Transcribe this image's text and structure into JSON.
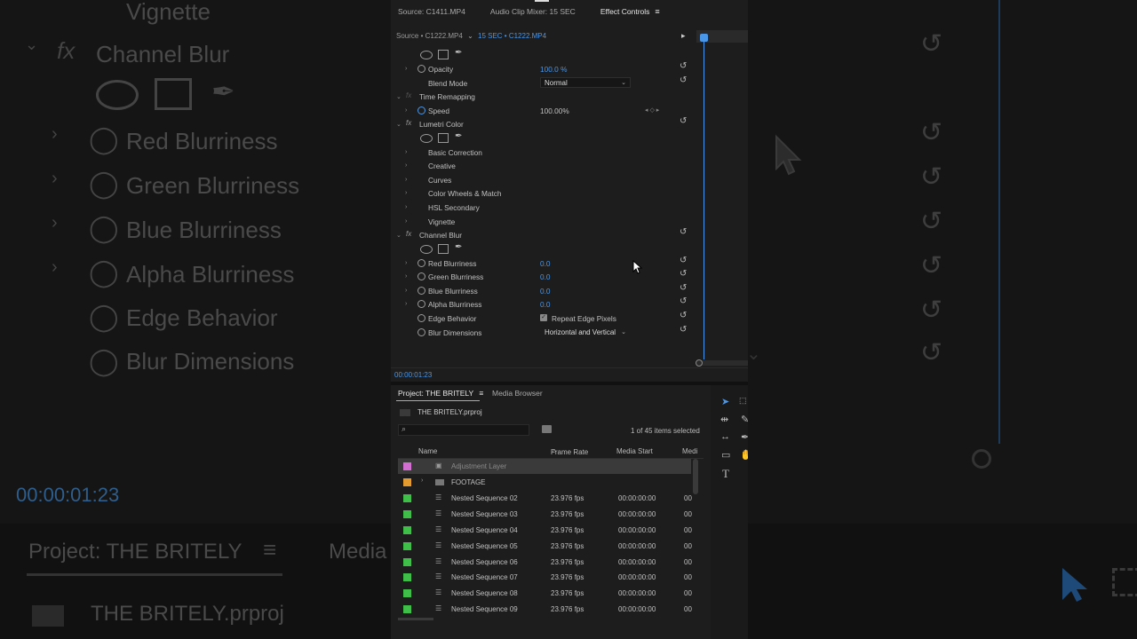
{
  "background": {
    "left_items": [
      "Vignette",
      "Channel Blur",
      "Red Blurriness",
      "Green Blurriness",
      "Blue Blurriness",
      "Alpha Blurriness",
      "Edge Behavior",
      "Blur Dimensions"
    ],
    "timecode": "00:00:01:23",
    "project_tab": "Project: THE BRITELY",
    "media_tab": "Media",
    "file": "THE BRITELY.prproj"
  },
  "tabs": {
    "source": "Source: C1411.MP4",
    "audio_mixer": "Audio Clip Mixer: 15 SEC",
    "effect_controls": "Effect Controls"
  },
  "source_bar": {
    "master": "Source • C1222.MP4",
    "sequence": "15 SEC • C1222.MP4"
  },
  "effects": {
    "opacity_label": "Opacity",
    "opacity_value": "100.0 %",
    "blend_label": "Blend Mode",
    "blend_value": "Normal",
    "time_remap": "Time Remapping",
    "speed_label": "Speed",
    "speed_value": "100.00%",
    "lumetri": "Lumetri Color",
    "lumetri_items": [
      "Basic Correction",
      "Creative",
      "Curves",
      "Color Wheels & Match",
      "HSL Secondary",
      "Vignette"
    ],
    "channel_blur": "Channel Blur",
    "red": "Red Blurriness",
    "red_value": "0.0",
    "green": "Green Blurriness",
    "green_value": "0.0",
    "blue": "Blue Blurriness",
    "blue_value": "0.0",
    "alpha": "Alpha Blurriness",
    "alpha_value": "0.0",
    "edge": "Edge Behavior",
    "edge_value": "Repeat Edge Pixels",
    "dims": "Blur Dimensions",
    "dims_value": "Horizontal and Vertical"
  },
  "timecode": "00:00:01:23",
  "project": {
    "tab": "Project: THE BRITELY",
    "media_browser": "Media Browser",
    "file": "THE BRITELY.prproj",
    "selection": "1 of 45 items selected",
    "columns": {
      "name": "Name",
      "frame_rate": "Frame Rate",
      "media_start": "Media Start",
      "more": "Medi"
    },
    "rows": [
      {
        "name": "Adjustment Layer",
        "fps": "",
        "start": "",
        "more": "",
        "color": "#d36fd3"
      },
      {
        "name": "FOOTAGE",
        "fps": "",
        "start": "",
        "more": "",
        "color": "#e39a2f"
      },
      {
        "name": "Nested Sequence 02",
        "fps": "23.976 fps",
        "start": "00:00:00:00",
        "more": "00",
        "color": "#3fbf4a"
      },
      {
        "name": "Nested Sequence 03",
        "fps": "23.976 fps",
        "start": "00:00:00:00",
        "more": "00",
        "color": "#3fbf4a"
      },
      {
        "name": "Nested Sequence 04",
        "fps": "23.976 fps",
        "start": "00:00:00:00",
        "more": "00",
        "color": "#3fbf4a"
      },
      {
        "name": "Nested Sequence 05",
        "fps": "23.976 fps",
        "start": "00:00:00:00",
        "more": "00",
        "color": "#3fbf4a"
      },
      {
        "name": "Nested Sequence 06",
        "fps": "23.976 fps",
        "start": "00:00:00:00",
        "more": "00",
        "color": "#3fbf4a"
      },
      {
        "name": "Nested Sequence 07",
        "fps": "23.976 fps",
        "start": "00:00:00:00",
        "more": "00",
        "color": "#3fbf4a"
      },
      {
        "name": "Nested Sequence 08",
        "fps": "23.976 fps",
        "start": "00:00:00:00",
        "more": "00",
        "color": "#3fbf4a"
      },
      {
        "name": "Nested Sequence 09",
        "fps": "23.976 fps",
        "start": "00:00:00:00",
        "more": "00",
        "color": "#3fbf4a"
      }
    ]
  },
  "accent": "#4a96e8"
}
